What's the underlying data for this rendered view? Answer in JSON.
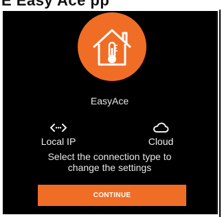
{
  "header": {
    "cut_text": "E...Easy...a..Ace...t..pp..."
  },
  "app": {
    "name": "EasyAce",
    "logo_icon": "house-thermometer-icon",
    "accent": "#f06d26"
  },
  "options": [
    {
      "label": "Local IP",
      "icon": "code-arrows-icon"
    },
    {
      "label": "Cloud",
      "icon": "cloud-icon"
    }
  ],
  "help_text_line1": "Select the connection type to",
  "help_text_line2": "change the settings",
  "continue_label": "CONTINUE"
}
